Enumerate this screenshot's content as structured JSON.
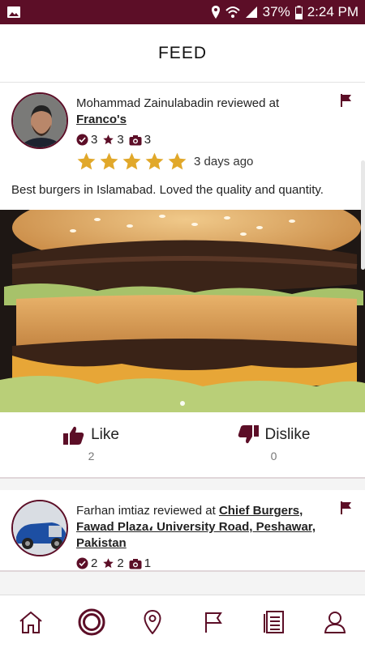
{
  "status_bar": {
    "battery": "37%",
    "time": "2:24 PM"
  },
  "header": {
    "title": "FEED"
  },
  "feed": [
    {
      "reviewer": "Mohammad Zainulabadin",
      "reviewed_at_text": "reviewed at",
      "place": "Franco's",
      "stats": {
        "checkins": "3",
        "reviews": "3",
        "photos": "3"
      },
      "rating": 5,
      "time_ago": "3 days ago",
      "review": "Best burgers in Islamabad. Loved the quality and quantity.",
      "like_label": "Like",
      "like_count": "2",
      "dislike_label": "Dislike",
      "dislike_count": "0"
    },
    {
      "reviewer": "Farhan imtiaz",
      "reviewed_at_text": "reviewed at",
      "place": "Chief Burgers, Fawad Plaza، University Road, Peshawar, Pakistan",
      "stats": {
        "checkins": "2",
        "reviews": "2",
        "photos": "1"
      }
    }
  ],
  "colors": {
    "brand": "#5c0e27",
    "star": "#e1a82a"
  },
  "nav": [
    "home-icon",
    "circle-logo-icon",
    "location-pin-icon",
    "flag-icon",
    "list-icon",
    "profile-icon"
  ]
}
